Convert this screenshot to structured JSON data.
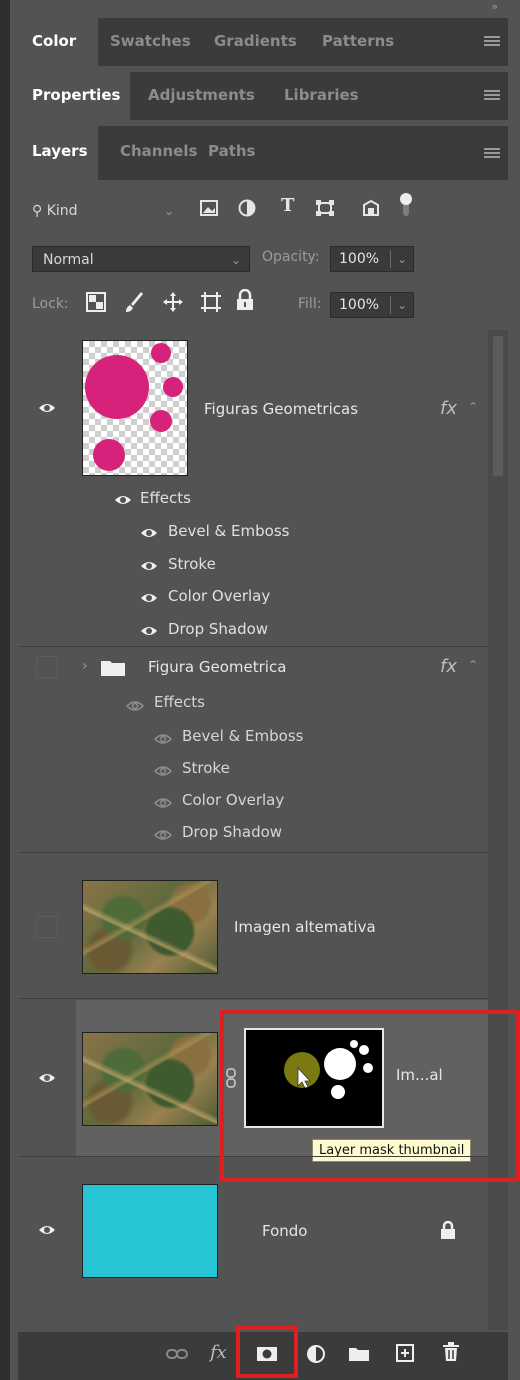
{
  "panels": {
    "color_group": {
      "tabs": [
        "Color",
        "Swatches",
        "Gradients",
        "Patterns"
      ]
    },
    "properties_group": {
      "tabs": [
        "Properties",
        "Adjustments",
        "Libraries"
      ]
    },
    "layers_group": {
      "tabs": [
        "Layers",
        "Channels",
        "Paths"
      ]
    }
  },
  "filter": {
    "kind_label": "Kind"
  },
  "blend": {
    "mode": "Normal",
    "opacity_label": "Opacity:",
    "opacity_value": "100%"
  },
  "lock": {
    "label": "Lock:",
    "fill_label": "Fill:",
    "fill_value": "100%"
  },
  "layers": [
    {
      "name": "Figuras Geometricas",
      "visible": true,
      "fx": "fx",
      "effects_label": "Effects",
      "effects": [
        "Bevel & Emboss",
        "Stroke",
        "Color Overlay",
        "Drop Shadow"
      ]
    },
    {
      "name": "Figura Geometrica",
      "visible": false,
      "fx": "fx",
      "effects_label": "Effects",
      "effects": [
        "Bevel & Emboss",
        "Stroke",
        "Color Overlay",
        "Drop Shadow"
      ]
    },
    {
      "name": "Imagen altemativa",
      "visible": false
    },
    {
      "name": "Im...al",
      "visible": true
    },
    {
      "name": "Fondo",
      "visible": true
    }
  ],
  "tooltip": "Layer mask thumbnail",
  "colors": {
    "magenta": "#d6227a",
    "cyan": "#27c4d4",
    "highlight": "#e02020"
  },
  "bottom_icons": [
    "link-icon",
    "fx-icon",
    "add-mask-icon",
    "adjustment-icon",
    "folder-icon",
    "new-layer-icon",
    "trash-icon"
  ]
}
